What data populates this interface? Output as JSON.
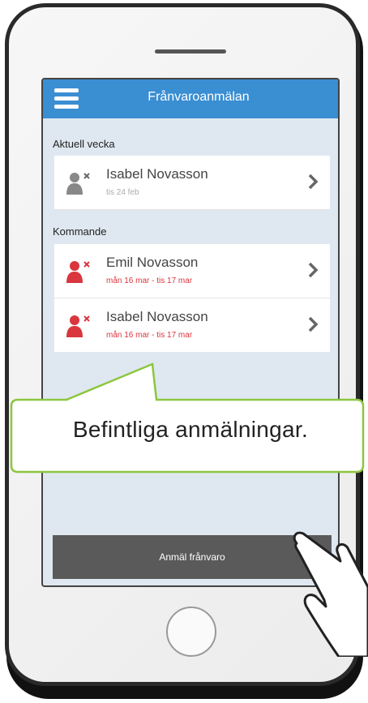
{
  "app": {
    "title": "Frånvaroanmälan"
  },
  "sections": [
    {
      "label": "Aktuell vecka",
      "rows": [
        {
          "name": "Isabel Novasson",
          "date": "tis 24 feb",
          "status": "past"
        }
      ]
    },
    {
      "label": "Kommande",
      "rows": [
        {
          "name": "Emil Novasson",
          "date": "mån 16 mar - tis 17 mar",
          "status": "upcoming"
        },
        {
          "name": "Isabel Novasson",
          "date": "mån 16 mar - tis 17 mar",
          "status": "upcoming"
        }
      ]
    }
  ],
  "bottom_button": {
    "label": "Anmäl frånvaro"
  },
  "callout": {
    "text": "Befintliga anmälningar."
  },
  "colors": {
    "appbar": "#3a8ed2",
    "upcoming": "#d9363e",
    "past": "#888888",
    "callout_border": "#8cc63f"
  },
  "icons": [
    "menu-icon",
    "person-remove-icon",
    "chevron-right-icon",
    "pointing-hand-icon"
  ]
}
